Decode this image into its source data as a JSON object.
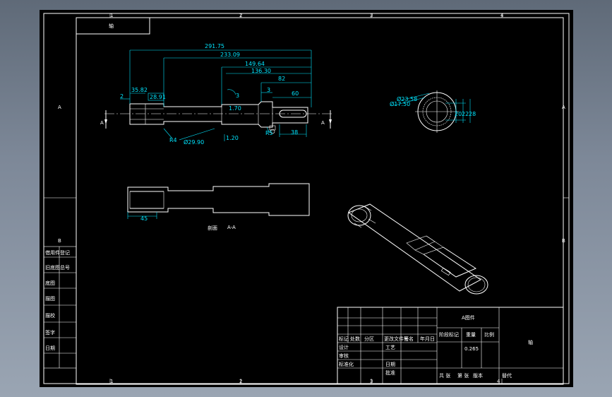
{
  "border": {
    "top_numbers": [
      "1",
      "2",
      "3",
      "4"
    ],
    "bottom_numbers": [
      "1",
      "2",
      "3",
      "4"
    ],
    "left_letters": [
      "A",
      "B"
    ],
    "right_letters": [
      "A",
      "B"
    ]
  },
  "corner_box_text": "轴",
  "dimensions": {
    "d291": "291.75",
    "d233": "233.09",
    "d149": "149.64",
    "d136": "136.30",
    "d82": "82",
    "d60": "60",
    "d3": "3",
    "d2": "2",
    "d35": "35.82",
    "d28": "28.91",
    "d170": "1.70",
    "d120": "1.20",
    "d38": "38",
    "r8": "R4",
    "r15": "R5",
    "dia1": "Ø29.90",
    "dia_top": "Ø23.58",
    "dia_left": "Ø17.50",
    "v1": "22",
    "v2": "28",
    "v3": "20",
    "section_len": "45"
  },
  "section_markers": {
    "left": "A",
    "right": "A"
  },
  "section_caption": {
    "title": "剖面",
    "label": "A-A"
  },
  "left_column_labels": [
    "借用件登记",
    "旧底图总号",
    "底图",
    "描图",
    "描校",
    "签字",
    "日期"
  ],
  "title_block": {
    "drawing_org": "A图件",
    "part_name": "轴",
    "scale_label": "重量",
    "scale_ratio": "比例",
    "stage_label": "阶段标记",
    "weight_value": "0.265",
    "sheet_total": "共 张",
    "sheet_no": "第 张",
    "version": "版本",
    "replace": "替代",
    "rev_headers": [
      "标记",
      "处数",
      "分区",
      "更改文件号",
      "签名",
      "年月日"
    ],
    "sign_rows": [
      "设计",
      "审核",
      "标准化",
      "工艺",
      "日期",
      "批准"
    ]
  }
}
